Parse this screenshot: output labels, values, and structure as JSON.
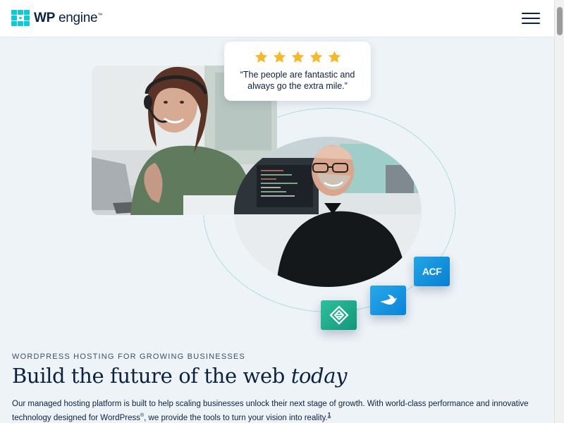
{
  "header": {
    "logo_bold": "WP",
    "logo_light": "engine",
    "logo_tm": "™",
    "menu_icon": "hamburger-menu-icon"
  },
  "hero": {
    "review": {
      "rating": 5,
      "quote": "“The people are fantastic and always go the extra mile.”"
    },
    "badges": [
      {
        "name": "ACF",
        "label": "ACF",
        "color": "#1a96e0"
      },
      {
        "name": "Flywheel",
        "icon": "flywheel-bird-icon",
        "color": "#1e9be4"
      },
      {
        "name": "Local",
        "icon": "local-diamond-icon",
        "color": "#22ad8d"
      }
    ],
    "eyebrow": "WORDPRESS HOSTING FOR GROWING BUSINESSES",
    "headline_main": "Build the future of the web ",
    "headline_em": "today",
    "intro_part1": "Our managed hosting platform is built to help scaling businesses unlock their next stage of growth. With world-class performance and innovative technology designed for WordPress",
    "intro_reg": "®",
    "intro_part2": ", we provide the tools to turn your vision into reality.",
    "intro_footnote": "1"
  },
  "colors": {
    "brand_navy": "#0b2240",
    "brand_teal": "#0ecad4",
    "page_bg": "#eef3f8",
    "star": "#f5b82e"
  }
}
